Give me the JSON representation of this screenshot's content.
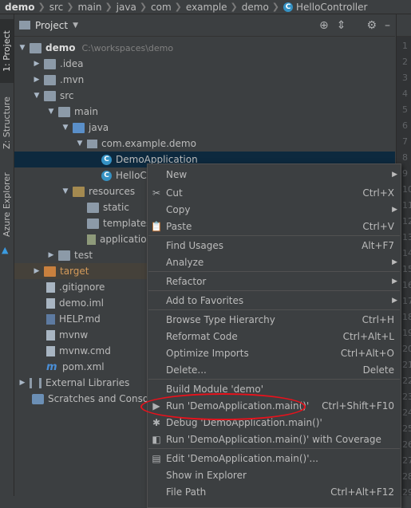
{
  "breadcrumb": [
    "demo",
    "src",
    "main",
    "java",
    "com",
    "example",
    "demo",
    "HelloController"
  ],
  "tool_strip": {
    "project_tab": "1: Project",
    "structure_tab": "Z: Structure",
    "azure_tab": "Azure Explorer"
  },
  "project_header": {
    "title": "Project"
  },
  "tree": {
    "root_label": "demo",
    "root_path": "C:\\workspaces\\demo",
    "idea": ".idea",
    "mvn": ".mvn",
    "src": "src",
    "main": "main",
    "java": "java",
    "package": "com.example.demo",
    "demo_application": "DemoApplication",
    "hello_controller": "HelloC",
    "resources": "resources",
    "static": "static",
    "templates": "templates",
    "application": "applicatio",
    "test": "test",
    "target": "target",
    "gitignore": ".gitignore",
    "demo_iml": "demo.iml",
    "help_md": "HELP.md",
    "mvnw": "mvnw",
    "mvnw_cmd": "mvnw.cmd",
    "pom_xml": "pom.xml",
    "external_libraries": "External Libraries",
    "scratches": "Scratches and Console"
  },
  "gutter_lines": [
    "1",
    "2",
    "3",
    "4",
    "5",
    "6",
    "7",
    "8",
    "9",
    "10",
    "11",
    "12",
    "13",
    "14",
    "15",
    "16",
    "17",
    "18",
    "19",
    "20",
    "21",
    "22",
    "23",
    "24",
    "25",
    "26",
    "27",
    "28",
    "29"
  ],
  "menu": {
    "new": "New",
    "cut": "Cut",
    "cut_sc": "Ctrl+X",
    "copy": "Copy",
    "paste": "Paste",
    "paste_sc": "Ctrl+V",
    "find_usages": "Find Usages",
    "find_usages_sc": "Alt+F7",
    "analyze": "Analyze",
    "refactor": "Refactor",
    "add_to_favorites": "Add to Favorites",
    "browse_type_hierarchy": "Browse Type Hierarchy",
    "browse_type_hierarchy_sc": "Ctrl+H",
    "reformat_code": "Reformat Code",
    "reformat_code_sc": "Ctrl+Alt+L",
    "optimize_imports": "Optimize Imports",
    "optimize_imports_sc": "Ctrl+Alt+O",
    "delete": "Delete...",
    "delete_sc": "Delete",
    "build_module": "Build Module 'demo'",
    "run": "Run 'DemoApplication.main()'",
    "run_sc": "Ctrl+Shift+F10",
    "debug": "Debug 'DemoApplication.main()'",
    "coverage": "Run 'DemoApplication.main()' with Coverage",
    "edit": "Edit 'DemoApplication.main()'...",
    "show_in_explorer": "Show in Explorer",
    "file_path": "File Path",
    "file_path_sc": "Ctrl+Alt+F12"
  }
}
